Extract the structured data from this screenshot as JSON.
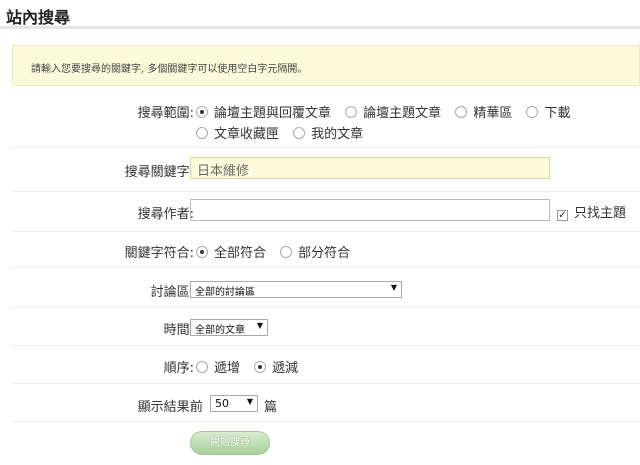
{
  "page": {
    "title": "站內搜尋"
  },
  "hint": {
    "text": "請輸入您要搜尋的關鍵字, 多個關鍵字可以使用空白字元隔開。"
  },
  "scope": {
    "label": "搜尋範圍:",
    "options": [
      {
        "label": "論壇主題與回覆文章",
        "checked": true
      },
      {
        "label": "論壇主題文章",
        "checked": false
      },
      {
        "label": "精華區",
        "checked": false
      },
      {
        "label": "下載",
        "checked": false
      },
      {
        "label": "文章收藏匣",
        "checked": false
      },
      {
        "label": "我的文章",
        "checked": false
      }
    ]
  },
  "keyword": {
    "label": "搜尋關鍵字:",
    "value": "日本維修"
  },
  "author": {
    "label": "搜尋作者:",
    "value": "",
    "topic_only_label": "只找主題",
    "topic_only_checked": true
  },
  "match": {
    "label": "關鍵字符合:",
    "options": [
      {
        "label": "全部符合",
        "checked": true
      },
      {
        "label": "部分符合",
        "checked": false
      }
    ]
  },
  "forum": {
    "label": "討論區:",
    "selected": "全部的討論區"
  },
  "time": {
    "label": "時間:",
    "selected": "全部的文章"
  },
  "order": {
    "label": "順序:",
    "options": [
      {
        "label": "遞增",
        "checked": false
      },
      {
        "label": "遞減",
        "checked": true
      }
    ]
  },
  "results": {
    "label": "顯示結果:",
    "prefix": "前",
    "selected": "50",
    "suffix": "篇"
  },
  "submit": {
    "label": "開始搜尋"
  }
}
